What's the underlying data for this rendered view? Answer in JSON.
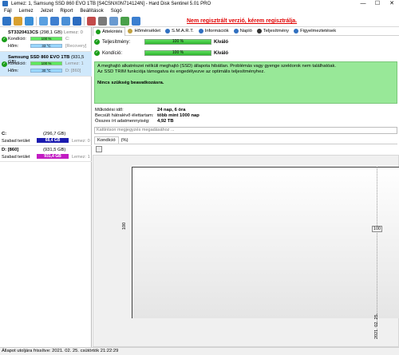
{
  "window": {
    "title": "Lemez: 1, Samsung SSD 860 EVO 1TB [S4CSNX0N714124N]  -  Hard Disk Sentinel 5.01 PRO",
    "minimize": "—",
    "maximize": "☐",
    "close": "✕"
  },
  "menu": [
    "Fájl",
    "Lemez",
    "Jelzet",
    "Riport",
    "Beállítások",
    "Súgó"
  ],
  "promo": "Nem regisztrált verzió, kérem regisztrálja.",
  "disks": [
    {
      "name": "ST3320413CS",
      "size": "(298,1 GB)",
      "disk_label": "Lemez: 0",
      "condition_label": "Kondíció:",
      "condition_value": "100 %",
      "condition_extra": "C:",
      "temp_label": "Hőm:",
      "temp_value": "33 °C",
      "temp_extra": "[Recovery]"
    },
    {
      "name": "Samsung SSD 860 EVO 1TB",
      "size": "(931,5 GB)",
      "disk_label": "",
      "condition_label": "Kondíció:",
      "condition_value": "100 %",
      "condition_extra": "Lemez: 1",
      "temp_label": "Hőm:",
      "temp_value": "30 °C",
      "temp_extra": "D: [860]"
    }
  ],
  "volumes": [
    {
      "name": "C:",
      "size": "(296,7 GB)",
      "free_label": "Szabad terület",
      "free_value": "68,4 GB",
      "disk": "Lemez: 0",
      "color": "#1c1cb0"
    },
    {
      "name": "D: [860]",
      "size": "(931,5 GB)",
      "free_label": "Szabad terület",
      "free_value": "931,4 GB",
      "disk": "Lemez: 1",
      "color": "#c21cc2"
    }
  ],
  "tabs": [
    {
      "label": "Áttekintés",
      "icon": "overview-icon",
      "color": "#1a9e1a"
    },
    {
      "label": "Hőmérséklet",
      "icon": "temperature-icon",
      "color": "#c0a040"
    },
    {
      "label": "S.M.A.R.T.",
      "icon": "smart-icon",
      "color": "#3070c0"
    },
    {
      "label": "Információk",
      "icon": "info-icon",
      "color": "#3070c0"
    },
    {
      "label": "Napló",
      "icon": "log-icon",
      "color": "#3070c0"
    },
    {
      "label": "Teljesítmény",
      "icon": "performance-icon",
      "color": "#333333"
    },
    {
      "label": "Figyelmeztetések",
      "icon": "alerts-icon",
      "color": "#3070c0"
    }
  ],
  "meters": [
    {
      "label": "Teljesítmény:",
      "value": "100 %",
      "status": "Kiváló"
    },
    {
      "label": "Kondíció:",
      "value": "100 %",
      "status": "Kiváló"
    }
  ],
  "info": {
    "line1": "A meghajtó alkatrészei nélküli meghajtó (SSD) állapota hibátlan. Problémás vagy gyenge szektorok nem találhatóak.",
    "line2": "Az SSD TRIM funkciója támogatva és engedélyezve az optimális teljesítményhez.",
    "action": "Nincs szükség beavatkozásra."
  },
  "stats": [
    {
      "label": "Működési idő:",
      "value": "24 nap, 6 óra"
    },
    {
      "label": "Becsült hátralévő élettartam:",
      "value": "több mint 1000 nap"
    },
    {
      "label": "Összes írt adatmennyiség:",
      "value": "4,92 TB"
    }
  ],
  "comment_placeholder": "Kattintson megjegyzés megadásához ...",
  "chart_tab": "Kondíció",
  "chart_tab2": "(%)",
  "chart_data": {
    "type": "line",
    "x": [
      "2021. 02. 25."
    ],
    "series": [
      {
        "values": [
          100
        ]
      }
    ],
    "ylabel_tick": "100",
    "data_label": "100"
  },
  "status": "Állapot utoljára frissítve: 2021. 02. 25. csütörtök 21:22:29"
}
